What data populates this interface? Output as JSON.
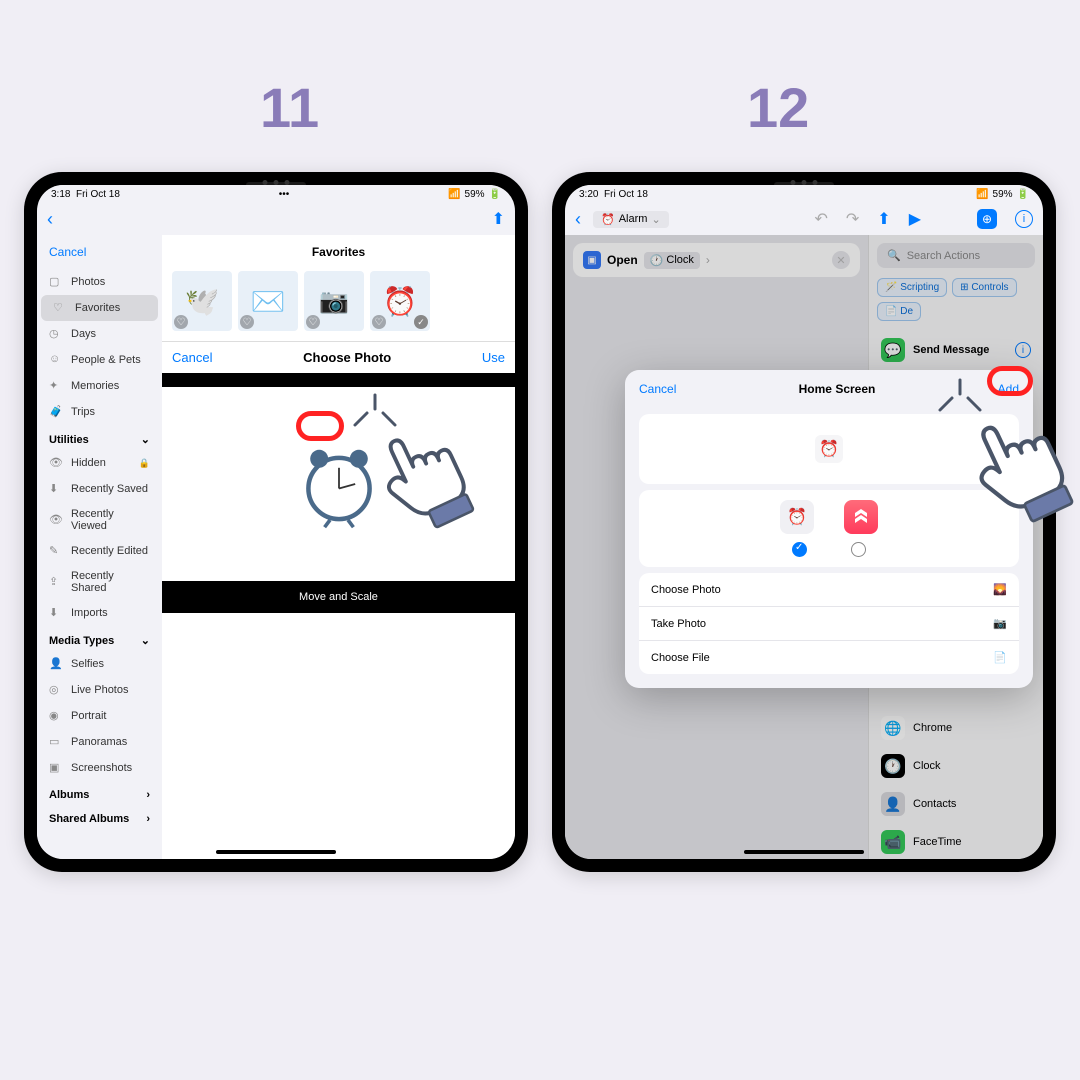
{
  "steps": {
    "s11": "11",
    "s12": "12"
  },
  "status": {
    "time11": "3:18",
    "time12": "3:20",
    "date": "Fri Oct 18",
    "battery": "59%",
    "wifi": "􀙇"
  },
  "s11": {
    "cancel": "Cancel",
    "title": "Favorites",
    "chooseBar": {
      "cancel": "Cancel",
      "title": "Choose Photo",
      "use": "Use"
    },
    "moveScale": "Move and Scale",
    "sidebar": {
      "items": [
        "Photos",
        "Favorites",
        "Days",
        "People & Pets",
        "Memories",
        "Trips"
      ],
      "utilities": "Utilities",
      "utilItems": [
        "Hidden",
        "Recently Saved",
        "Recently Viewed",
        "Recently Edited",
        "Recently Shared",
        "Imports"
      ],
      "media": "Media Types",
      "mediaItems": [
        "Selfies",
        "Live Photos",
        "Portrait",
        "Panoramas",
        "Screenshots"
      ],
      "albums": "Albums",
      "shared": "Shared Albums"
    }
  },
  "s12": {
    "shortcut": {
      "name": "Alarm",
      "action": "Open",
      "target": "Clock"
    },
    "search": "Search Actions",
    "tags": {
      "scripting": "Scripting",
      "controls": "Controls",
      "d": "De"
    },
    "sendMsg": "Send Message",
    "apps": [
      "Chrome",
      "Clock",
      "Contacts",
      "FaceTime"
    ],
    "sheet": {
      "cancel": "Cancel",
      "title": "Home Screen",
      "add": "Add",
      "choosePhoto": "Choose Photo",
      "takePhoto": "Take Photo",
      "chooseFile": "Choose File"
    }
  }
}
